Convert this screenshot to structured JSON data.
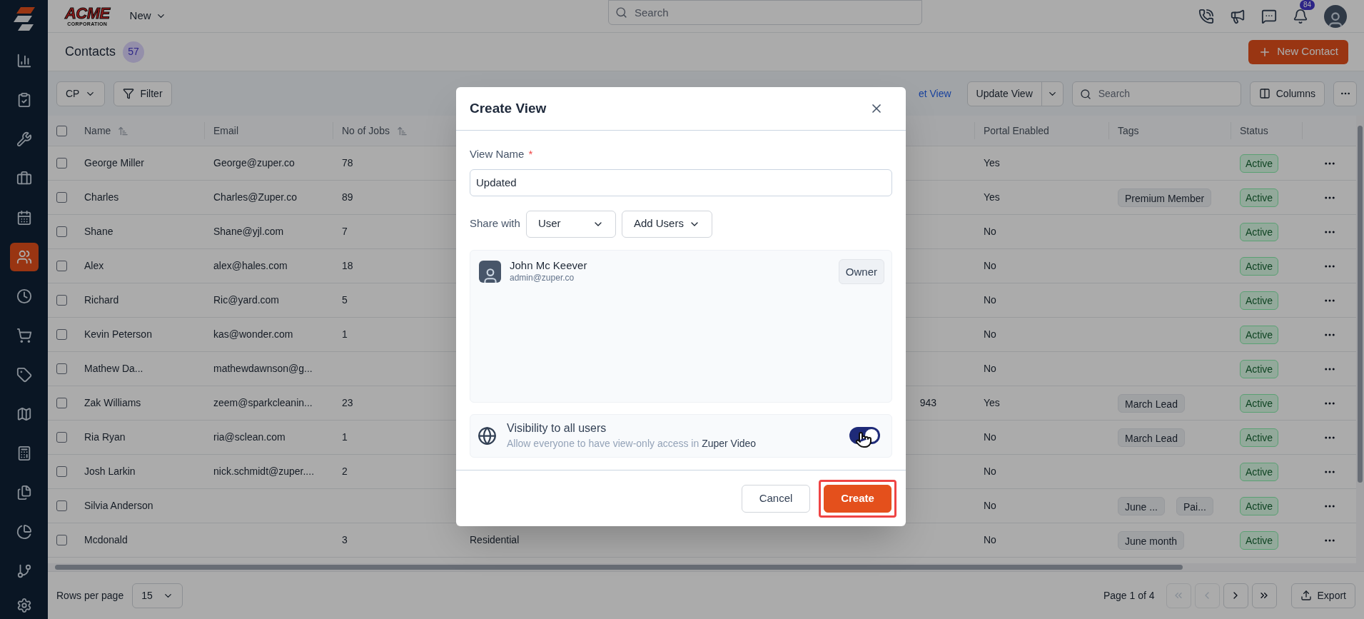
{
  "sidebar": {
    "items": [
      {
        "kind": "reports",
        "selected": false
      },
      {
        "kind": "jobs",
        "selected": false
      },
      {
        "kind": "tools",
        "selected": false
      },
      {
        "kind": "briefcase",
        "selected": false
      },
      {
        "kind": "calendar",
        "selected": false
      },
      {
        "kind": "contacts",
        "selected": true
      },
      {
        "kind": "clock",
        "selected": false
      },
      {
        "kind": "cart",
        "selected": false
      },
      {
        "kind": "tag",
        "selected": false
      },
      {
        "kind": "map",
        "selected": false
      },
      {
        "kind": "calculator",
        "selected": false
      },
      {
        "kind": "files",
        "selected": false
      },
      {
        "kind": "pie",
        "selected": false
      },
      {
        "kind": "branch",
        "selected": false
      }
    ]
  },
  "topbar": {
    "logo": {
      "name": "ACME",
      "subtitle": "CORPORATION"
    },
    "new_menu": "New",
    "search": {
      "placeholder": "Search"
    },
    "notifications_badge": "84"
  },
  "page": {
    "title": "Contacts",
    "count": "57",
    "new_button": "New Contact"
  },
  "toolbar": {
    "view_select": "CP",
    "filter": "Filter",
    "link": "et View",
    "update_view": "Update View",
    "search": {
      "placeholder": "Search"
    },
    "columns": "Columns"
  },
  "table": {
    "all_checked": false,
    "columns": [
      {
        "label": "Name",
        "sortable": true
      },
      {
        "label": "Email",
        "sortable": false
      },
      {
        "label": "No of Jobs",
        "sortable": true
      },
      {
        "label": "Portal Enabled",
        "sortable": false
      },
      {
        "label": "Tags",
        "sortable": false
      },
      {
        "label": "Status",
        "sortable": false
      }
    ],
    "rows": [
      {
        "checked": false,
        "name": "George Miller",
        "email": "George@zuper.co",
        "jobs": "78",
        "portal_enabled": "Yes",
        "tags": [],
        "status": "Active"
      },
      {
        "checked": false,
        "name": "Charles",
        "email": "Charles@Zuper.co",
        "jobs": "89",
        "portal_enabled": "Yes",
        "tags": [
          "Premium Member"
        ],
        "status": "Active"
      },
      {
        "checked": false,
        "name": "Shane",
        "email": "Shane@yjl.com",
        "jobs": "7",
        "portal_enabled": "No",
        "tags": [],
        "status": "Active"
      },
      {
        "checked": false,
        "name": "Alex",
        "email": "alex@hales.com",
        "jobs": "18",
        "portal_enabled": "No",
        "tags": [],
        "status": "Active"
      },
      {
        "checked": false,
        "name": "Richard",
        "email": "Ric@yard.com",
        "jobs": "5",
        "portal_enabled": "No",
        "tags": [],
        "status": "Active"
      },
      {
        "checked": false,
        "name": "Kevin Peterson",
        "email": "kas@wonder.com",
        "jobs": "1",
        "portal_enabled": "No",
        "tags": [],
        "status": "Active"
      },
      {
        "checked": false,
        "name": "Mathew Da...",
        "email": "mathewdawnson@g...",
        "portal_enabled": "No",
        "tags": [],
        "status": "Active"
      },
      {
        "checked": false,
        "name": "Zak Williams",
        "email": "zeem@sparkcleanin...",
        "jobs": "23",
        "column_5": "943",
        "portal_enabled": "Yes",
        "tags": [
          "March Lead"
        ],
        "status": "Active"
      },
      {
        "checked": false,
        "name": "Ria Ryan",
        "email": "ria@sclean.com",
        "jobs": "1",
        "portal_enabled": "No",
        "tags": [
          "March Lead"
        ],
        "status": "Active"
      },
      {
        "checked": false,
        "name": "Josh Larkin",
        "email": "nick.schmidt@zuper....",
        "jobs": "2",
        "portal_enabled": "No",
        "tags": [],
        "status": "Active"
      },
      {
        "checked": false,
        "name": "Silvia Anderson",
        "portal_enabled": "No",
        "tags": [
          "June ...",
          "Pai..."
        ],
        "status": "Active"
      },
      {
        "checked": false,
        "name": "Mcdonald",
        "jobs": "3",
        "column_4": "Residential",
        "portal_enabled": "No",
        "tags": [
          "June month"
        ],
        "status": "Active"
      }
    ]
  },
  "footer": {
    "rows_per_page": {
      "label": "Rows per page",
      "value": "15"
    },
    "page_info": "Page 1 of 4",
    "pagination": [
      {
        "kind": "first",
        "disabled": true
      },
      {
        "kind": "prev",
        "disabled": true
      },
      {
        "kind": "next",
        "disabled": false
      },
      {
        "kind": "last",
        "disabled": false
      }
    ],
    "export": "Export"
  },
  "modal": {
    "title": "Create View",
    "view_name": {
      "label": "View Name",
      "required_mark": "*",
      "value": "Updated"
    },
    "share_with": {
      "label": "Share with",
      "role_select": "User",
      "add_users": "Add Users"
    },
    "users": [
      {
        "name": "John Mc Keever",
        "email": "admin@zuper.co",
        "role": "Owner"
      }
    ],
    "visibility": {
      "title": "Visibility to all users",
      "description": "Allow everyone to have view-only access in **Zuper Video**",
      "on": true
    },
    "buttons": [
      {
        "label": "Cancel",
        "kind": "secondary",
        "highlighted": false
      },
      {
        "label": "Create",
        "kind": "primary",
        "highlighted": true
      }
    ]
  }
}
